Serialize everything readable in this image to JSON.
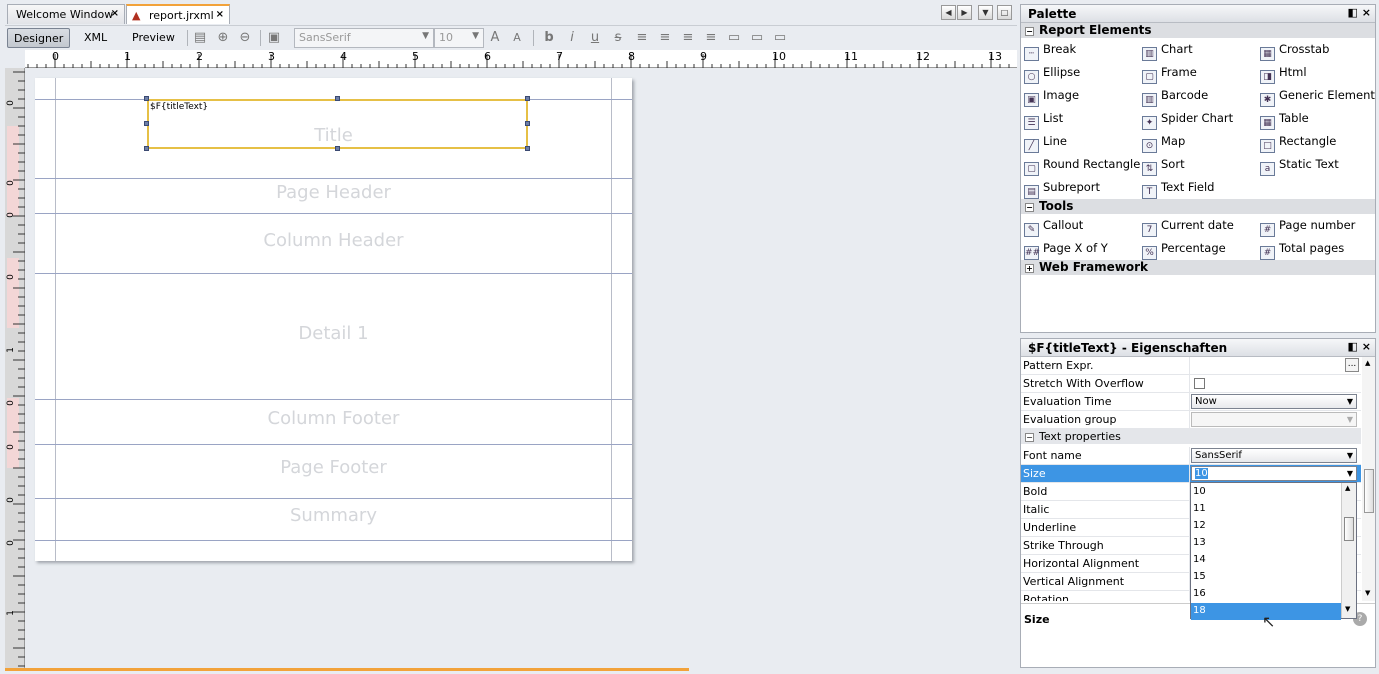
{
  "tabs": [
    {
      "label": "Welcome Window",
      "active": false
    },
    {
      "label": "report.jrxml",
      "active": true
    }
  ],
  "toolbar": {
    "designer": "Designer",
    "xml": "XML",
    "preview": "Preview",
    "font_name": "SansSerif",
    "font_size": "10"
  },
  "ruler": {
    "h": [
      "0",
      "1",
      "2",
      "3",
      "4",
      "5",
      "6",
      "7",
      "8",
      "9",
      "10",
      "11",
      "12",
      "13"
    ],
    "v": [
      "0",
      "0",
      "0",
      "0",
      "1",
      "0",
      "0",
      "0",
      "0",
      "1"
    ]
  },
  "report": {
    "field_expr": "$F{titleText}",
    "bands": [
      "Title",
      "Page Header",
      "Column Header",
      "Detail 1",
      "Column Footer",
      "Page Footer",
      "Summary"
    ]
  },
  "palette": {
    "title": "Palette",
    "report_elements_label": "Report Elements",
    "report_elements": [
      "Break",
      "Chart",
      "Crosstab",
      "Ellipse",
      "Frame",
      "Html",
      "Image",
      "Barcode",
      "Generic Element",
      "List",
      "Spider Chart",
      "Table",
      "Line",
      "Map",
      "Rectangle",
      "Round Rectangle",
      "Sort",
      "Static Text",
      "Subreport",
      "Text Field"
    ],
    "tools_label": "Tools",
    "tools": [
      "Callout",
      "Current date",
      "Page number",
      "Page X of Y",
      "Percentage",
      "Total pages"
    ],
    "web_framework_label": "Web Framework"
  },
  "properties": {
    "title": "$F{titleText} - Eigenschaften",
    "rows": [
      {
        "key": "Pattern Expr.",
        "value": "..."
      },
      {
        "key": "Stretch With Overflow",
        "value": ""
      },
      {
        "key": "Evaluation Time",
        "value": "Now"
      },
      {
        "key": "Evaluation group",
        "value": ""
      }
    ],
    "section_label": "Text properties",
    "text_rows": [
      {
        "key": "Font name",
        "value": "SansSerif"
      },
      {
        "key": "Size",
        "value": "10"
      },
      {
        "key": "Bold",
        "value": ""
      },
      {
        "key": "Italic",
        "value": ""
      },
      {
        "key": "Underline",
        "value": ""
      },
      {
        "key": "Strike Through",
        "value": ""
      },
      {
        "key": "Horizontal Alignment",
        "value": ""
      },
      {
        "key": "Vertical Alignment",
        "value": ""
      },
      {
        "key": "Rotation",
        "value": ""
      }
    ],
    "size_options": [
      "10",
      "11",
      "12",
      "13",
      "14",
      "15",
      "16",
      "18"
    ],
    "size_selected": "18",
    "footer_label": "Size"
  }
}
